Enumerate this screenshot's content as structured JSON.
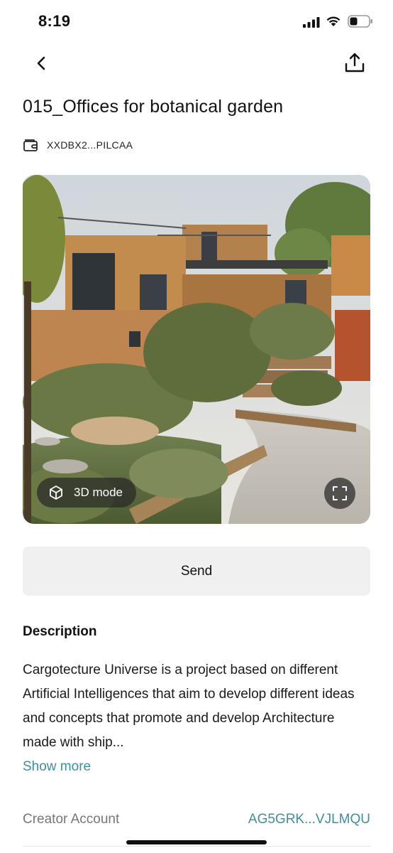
{
  "status_bar": {
    "time": "8:19",
    "icons": [
      "signal-icon",
      "wifi-icon",
      "battery-icon"
    ]
  },
  "nav": {
    "back_icon": "chevron-left-icon",
    "share_icon": "share-upload-icon"
  },
  "title": "015_Offices for botanical garden",
  "wallet": {
    "icon": "wallet-icon",
    "address": "XXDBX2...PILCAA"
  },
  "hero": {
    "mode_label": "3D mode",
    "mode_icon": "cube-icon",
    "fullscreen_icon": "fullscreen-icon"
  },
  "send_label": "Send",
  "description": {
    "heading": "Description",
    "text": "Cargotecture Universe is a project based on different Artificial Intelligences that aim to develop different ideas and concepts that promote and develop Architecture made with ship...",
    "show_more": "Show more"
  },
  "creator": {
    "label": "Creator Account",
    "value": "AG5GRK...VJLMQU"
  },
  "colors": {
    "accent": "#3f8f9c",
    "button_bg": "#f0f0f0",
    "pill_bg": "#282828"
  }
}
